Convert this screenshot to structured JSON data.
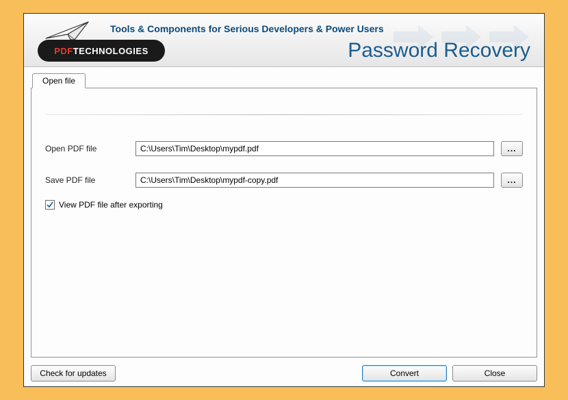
{
  "header": {
    "tagline": "Tools & Components for Serious Developers & Power Users",
    "logo_pdf": "PDF",
    "logo_tech": "TECHNOLOGIES",
    "app_title": "Password Recovery"
  },
  "tabs": {
    "open_file": "Open file"
  },
  "form": {
    "open_label": "Open PDF file",
    "open_value": "C:\\Users\\Tim\\Desktop\\mypdf.pdf",
    "save_label": "Save PDF file",
    "save_value": "C:\\Users\\Tim\\Desktop\\mypdf-copy.pdf",
    "browse_label": "...",
    "view_after_label": "View PDF file after exporting",
    "view_after_checked": true
  },
  "footer": {
    "updates": "Check for updates",
    "convert": "Convert",
    "close": "Close"
  }
}
